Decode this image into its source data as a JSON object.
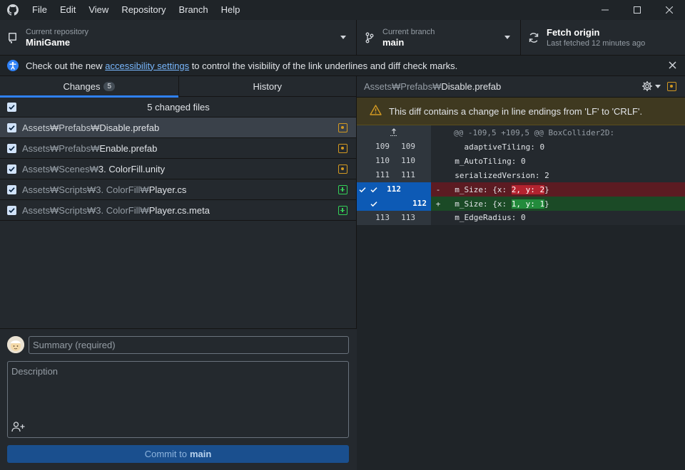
{
  "menu": [
    "File",
    "Edit",
    "View",
    "Repository",
    "Branch",
    "Help"
  ],
  "toolbar": {
    "repo_label": "Current repository",
    "repo_value": "MiniGame",
    "branch_label": "Current branch",
    "branch_value": "main",
    "fetch_label": "Fetch origin",
    "fetch_sub": "Last fetched 12 minutes ago"
  },
  "banner": {
    "pre": "Check out the new ",
    "link": "accessibility settings",
    "post": " to control the visibility of the link underlines and diff check marks."
  },
  "tabs": {
    "changes": "Changes",
    "changes_count": "5",
    "history": "History"
  },
  "changes": {
    "header": "5 changed files",
    "files": [
      {
        "dir": "Assets₩Prefabs₩",
        "name": "Disable.prefab",
        "status": "modified"
      },
      {
        "dir": "Assets₩Prefabs₩",
        "name": "Enable.prefab",
        "status": "modified"
      },
      {
        "dir": "Assets₩Scenes₩",
        "name": "3. ColorFill.unity",
        "status": "modified"
      },
      {
        "dir": "Assets₩Scripts₩3. ColorFill₩",
        "name": "Player.cs",
        "status": "added"
      },
      {
        "dir": "Assets₩Scripts₩3. ColorFill₩",
        "name": "Player.cs.meta",
        "status": "added"
      }
    ]
  },
  "commit": {
    "summary_placeholder": "Summary (required)",
    "description_placeholder": "Description",
    "button_prefix": "Commit to",
    "button_branch": "main"
  },
  "diff": {
    "path_dir": "Assets₩Prefabs₩",
    "path_name": "Disable.prefab",
    "warning": "This diff contains a change in line endings from 'LF' to 'CRLF'.",
    "hunk": "@@ -109,5 +109,5 @@ BoxCollider2D:",
    "lines": [
      {
        "old": "109",
        "new": "109",
        "code": "    adaptiveTiling: 0"
      },
      {
        "old": "110",
        "new": "110",
        "code": "  m_AutoTiling: 0"
      },
      {
        "old": "111",
        "new": "111",
        "code": "  serializedVersion: 2"
      }
    ],
    "del": {
      "old": "112",
      "sign": "-",
      "pre": "  m_Size: {x: ",
      "hl": "2, y: 2",
      "post": "}"
    },
    "add": {
      "new": "112",
      "sign": "+",
      "pre": "  m_Size: {x: ",
      "hl": "1, y: 1",
      "post": "}"
    },
    "last": {
      "old": "113",
      "new": "113",
      "code": "  m_EdgeRadius: 0"
    }
  },
  "colors": {
    "accent": "#2f81f7",
    "modified": "#d29922",
    "added": "#34d058",
    "deleted_bg": "#5c1b22",
    "added_bg": "#1b4a26"
  }
}
